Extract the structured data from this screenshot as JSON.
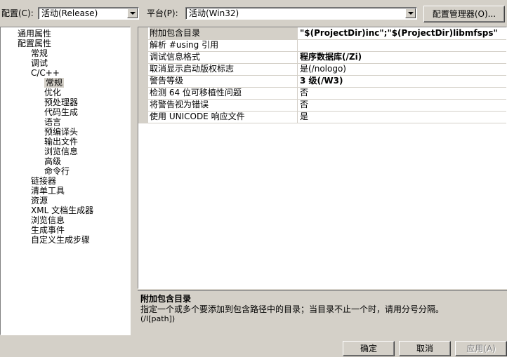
{
  "toolbar": {
    "config_label": "配置(C):",
    "config_value": "活动(Release)",
    "platform_label": "平台(P):",
    "platform_value": "活动(Win32)",
    "config_manager_label": "配置管理器(O)..."
  },
  "tree": {
    "items": [
      {
        "label": "通用属性"
      },
      {
        "label": "配置属性"
      },
      {
        "label": "常规"
      },
      {
        "label": "调试"
      },
      {
        "label": "C/C++"
      },
      {
        "label": "常规"
      },
      {
        "label": "优化"
      },
      {
        "label": "预处理器"
      },
      {
        "label": "代码生成"
      },
      {
        "label": "语言"
      },
      {
        "label": "预编译头"
      },
      {
        "label": "输出文件"
      },
      {
        "label": "浏览信息"
      },
      {
        "label": "高级"
      },
      {
        "label": "命令行"
      },
      {
        "label": "链接器"
      },
      {
        "label": "清单工具"
      },
      {
        "label": "资源"
      },
      {
        "label": "XML 文档生成器"
      },
      {
        "label": "浏览信息"
      },
      {
        "label": "生成事件"
      },
      {
        "label": "自定义生成步骤"
      }
    ]
  },
  "grid": {
    "rows": [
      {
        "name": "附加包含目录",
        "value": "\"$(ProjectDir)inc\";\"$(ProjectDir)libmfsps\""
      },
      {
        "name": "解析 #using 引用",
        "value": ""
      },
      {
        "name": "调试信息格式",
        "value": "程序数据库(/Zi)"
      },
      {
        "name": "取消显示启动版权标志",
        "value": "是(/nologo)"
      },
      {
        "name": "警告等级",
        "value": "3 级(/W3)"
      },
      {
        "name": "检测 64 位可移植性问题",
        "value": "否"
      },
      {
        "name": "将警告视为错误",
        "value": "否"
      },
      {
        "name": "使用 UNICODE 响应文件",
        "value": "是"
      }
    ]
  },
  "description": {
    "title": "附加包含目录",
    "text": "指定一个或多个要添加到包含路径中的目录；当目录不止一个时，请用分号分隔。",
    "switch": "(/I[path])"
  },
  "footer": {
    "ok_label": "确定",
    "cancel_label": "取消",
    "apply_label": "应用(A)"
  }
}
